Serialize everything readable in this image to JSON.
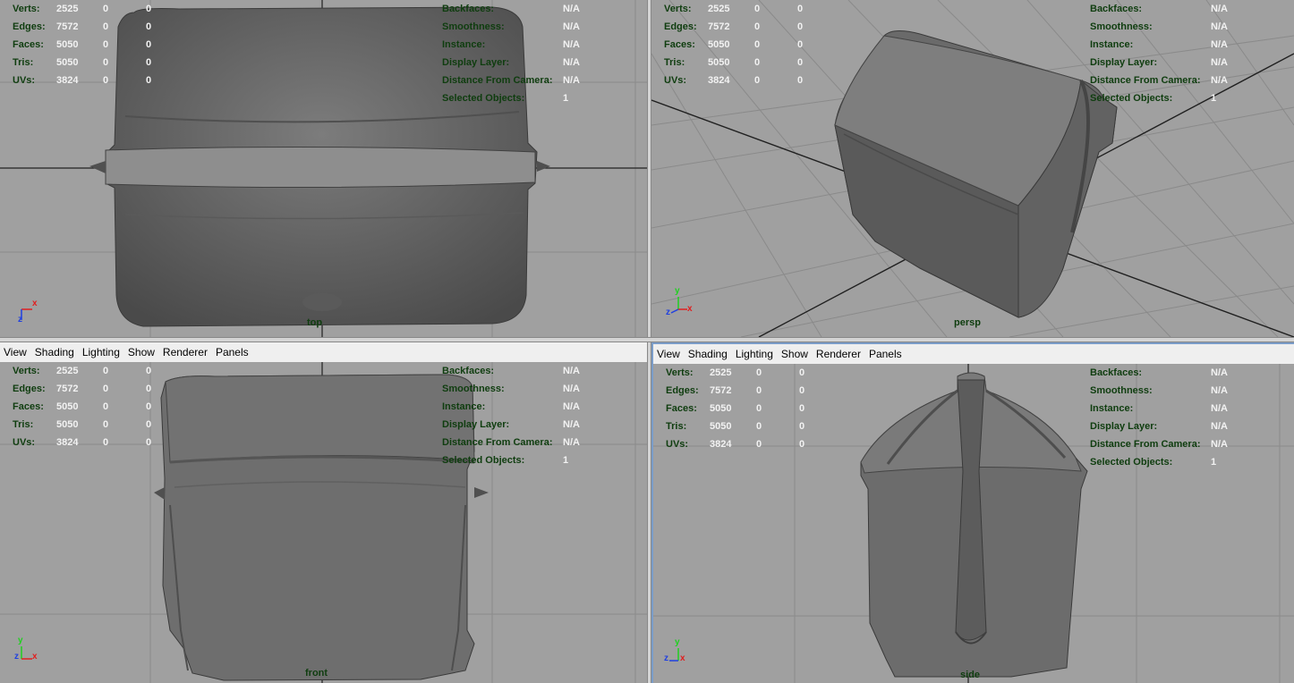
{
  "menu": [
    "View",
    "Shading",
    "Lighting",
    "Show",
    "Renderer",
    "Panels"
  ],
  "hud": {
    "left": [
      {
        "label": "Verts:",
        "v1": "2525",
        "v2": "0",
        "v3": "0"
      },
      {
        "label": "Edges:",
        "v1": "7572",
        "v2": "0",
        "v3": "0"
      },
      {
        "label": "Faces:",
        "v1": "5050",
        "v2": "0",
        "v3": "0"
      },
      {
        "label": "Tris:",
        "v1": "5050",
        "v2": "0",
        "v3": "0"
      },
      {
        "label": "UVs:",
        "v1": "3824",
        "v2": "0",
        "v3": "0"
      }
    ],
    "right": [
      {
        "label": "Backfaces:",
        "value": "N/A"
      },
      {
        "label": "Smoothness:",
        "value": "N/A"
      },
      {
        "label": "Instance:",
        "value": "N/A"
      },
      {
        "label": "Display Layer:",
        "value": "N/A"
      },
      {
        "label": "Distance From Camera:",
        "value": "N/A"
      },
      {
        "label": "Selected Objects:",
        "value": "1"
      }
    ]
  },
  "panes": {
    "top": {
      "camera": "top"
    },
    "persp": {
      "camera": "persp"
    },
    "front": {
      "camera": "front"
    },
    "side": {
      "camera": "side"
    }
  },
  "axis_labels": {
    "x": "x",
    "y": "y",
    "z": "z"
  },
  "colors": {
    "viewport_bg": "#a0a0a0",
    "grid": "#8a8a8a",
    "grid_axis": "#202020",
    "hud_label": "#0f3d0f",
    "hud_value": "#f2f2f2",
    "axis_x": "#e02020",
    "axis_y": "#20d020",
    "axis_z": "#2040e0",
    "model": "#6e6e6e",
    "active_pane_border": "#7a9cc8"
  }
}
